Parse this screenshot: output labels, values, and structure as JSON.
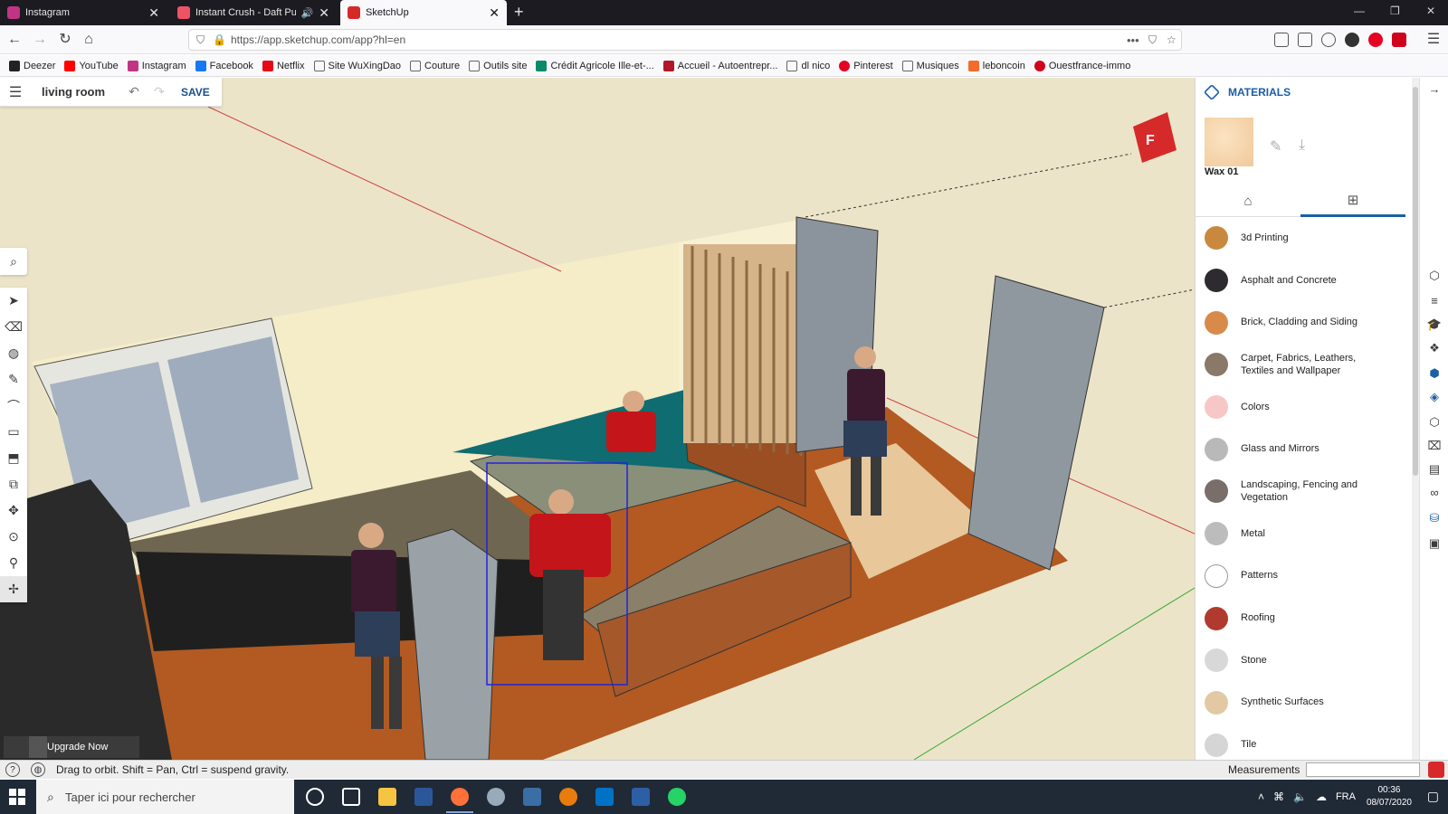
{
  "browser": {
    "tabs": [
      {
        "title": "Instagram",
        "close": "✕"
      },
      {
        "title": "Instant Crush - Daft Punk -",
        "audio": "🔊",
        "close": "✕"
      },
      {
        "title": "SketchUp",
        "close": "✕"
      }
    ],
    "new_tab": "+",
    "url": "https://app.sketchup.com/app?hl=en",
    "bookmarks": [
      {
        "label": "Deezer",
        "color": "#222222"
      },
      {
        "label": "YouTube",
        "color": "#ff0000"
      },
      {
        "label": "Instagram",
        "color": "#c13584"
      },
      {
        "label": "Facebook",
        "color": "#1877f2"
      },
      {
        "label": "Netflix",
        "color": "#e50914"
      },
      {
        "label": "Site WuXingDao",
        "color": "#8a8a8a"
      },
      {
        "label": "Couture",
        "color": "#8a8a8a"
      },
      {
        "label": "Outils site",
        "color": "#8a8a8a"
      },
      {
        "label": "Crédit Agricole Ille-et-...",
        "color": "#0a8a6a"
      },
      {
        "label": "Accueil - Autoentrepr...",
        "color": "#b0182a"
      },
      {
        "label": "dl nico",
        "color": "#8a8a8a"
      },
      {
        "label": "Pinterest",
        "color": "#e60023"
      },
      {
        "label": "Musiques",
        "color": "#8a8a8a"
      },
      {
        "label": "leboncoin",
        "color": "#f56b2a"
      },
      {
        "label": "Ouestfrance-immo",
        "color": "#d0021b"
      }
    ]
  },
  "app": {
    "project_name": "living room",
    "save_label": "SAVE",
    "upgrade_label": "Upgrade Now",
    "status_text": "Drag to orbit. Shift = Pan, Ctrl = suspend gravity.",
    "measurements_label": "Measurements"
  },
  "materials": {
    "title": "MATERIALS",
    "current_material": "Wax 01",
    "categories": [
      {
        "label": "3d Printing",
        "color": "#c8893f"
      },
      {
        "label": "Asphalt and Concrete",
        "color": "#2e2b30"
      },
      {
        "label": "Brick, Cladding and Siding",
        "color": "#d78a4a"
      },
      {
        "label": "Carpet, Fabrics, Leathers, Textiles and Wallpaper",
        "color": "#8a7868"
      },
      {
        "label": "Colors",
        "color": "#f7c6c6"
      },
      {
        "label": "Glass and Mirrors",
        "color": "#b9b9b9"
      },
      {
        "label": "Landscaping, Fencing and Vegetation",
        "color": "#7a6e6a"
      },
      {
        "label": "Metal",
        "color": "#bcbcbc"
      },
      {
        "label": "Patterns",
        "color": "#ffffff"
      },
      {
        "label": "Roofing",
        "color": "#b03a2e"
      },
      {
        "label": "Stone",
        "color": "#d8d8d8"
      },
      {
        "label": "Synthetic Surfaces",
        "color": "#e2c9a3"
      },
      {
        "label": "Tile",
        "color": "#d5d5d5"
      }
    ]
  },
  "taskbar": {
    "search_placeholder": "Taper ici pour rechercher",
    "language": "FRA",
    "time": "00:36",
    "date": "08/07/2020"
  }
}
